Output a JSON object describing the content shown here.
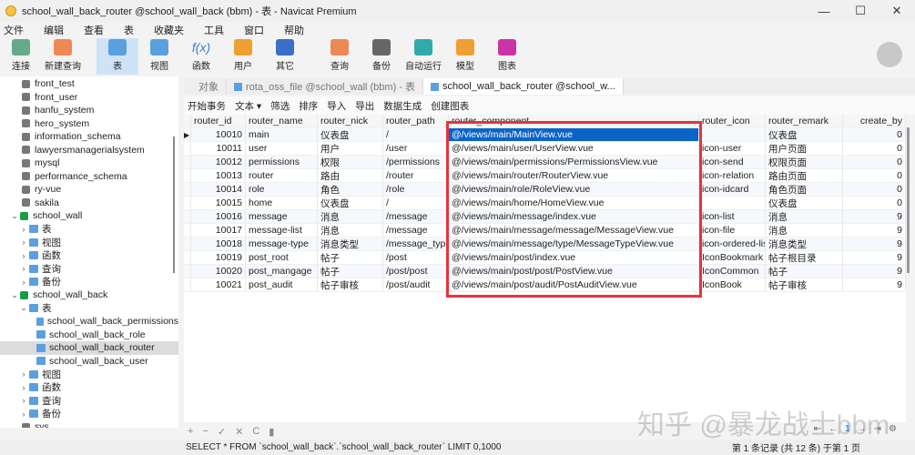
{
  "window": {
    "title": "school_wall_back_router @school_wall_back (bbm) - 表 - Navicat Premium",
    "controls": [
      "—",
      "☐",
      "✕"
    ]
  },
  "menu": [
    "文件",
    "编辑",
    "查看",
    "表",
    "收藏夹",
    "工具",
    "窗口",
    "帮助"
  ],
  "toolbar": [
    {
      "label": "连接",
      "icon": "plug-icon",
      "color": "#6a8"
    },
    {
      "label": "新建查询",
      "icon": "new-query-icon",
      "color": "#e85"
    },
    {
      "label": "表",
      "icon": "table-icon",
      "color": "#5aa0e0",
      "active": true
    },
    {
      "label": "视图",
      "icon": "view-icon",
      "color": "#5aa0e0"
    },
    {
      "label": "函数",
      "icon": "function-icon",
      "color": "#3a7bd5",
      "glyph": "f(x)"
    },
    {
      "label": "用户",
      "icon": "user-icon",
      "color": "#f0a030"
    },
    {
      "label": "其它",
      "icon": "other-icon",
      "color": "#3a6fc8"
    },
    {
      "label": "查询",
      "icon": "query-icon",
      "color": "#e85"
    },
    {
      "label": "备份",
      "icon": "backup-icon",
      "color": "#666"
    },
    {
      "label": "自动运行",
      "icon": "robot-icon",
      "color": "#3aa"
    },
    {
      "label": "模型",
      "icon": "model-icon",
      "color": "#f0a030"
    },
    {
      "label": "图表",
      "icon": "chart-icon",
      "color": "#c3a"
    }
  ],
  "sidebar": [
    {
      "label": "front_test",
      "level": 1,
      "type": "db"
    },
    {
      "label": "front_user",
      "level": 1,
      "type": "db"
    },
    {
      "label": "hanfu_system",
      "level": 1,
      "type": "db"
    },
    {
      "label": "hero_system",
      "level": 1,
      "type": "db"
    },
    {
      "label": "information_schema",
      "level": 1,
      "type": "db"
    },
    {
      "label": "lawyersmanagerialsystem",
      "level": 1,
      "type": "db"
    },
    {
      "label": "mysql",
      "level": 1,
      "type": "db"
    },
    {
      "label": "performance_schema",
      "level": 1,
      "type": "db"
    },
    {
      "label": "ry-vue",
      "level": 1,
      "type": "db"
    },
    {
      "label": "sakila",
      "level": 1,
      "type": "db"
    },
    {
      "label": "school_wall",
      "level": 0,
      "type": "dbopen",
      "chev": "⌄"
    },
    {
      "label": "表",
      "level": 1,
      "type": "folder",
      "chev": "›"
    },
    {
      "label": "视图",
      "level": 1,
      "type": "folder",
      "chev": "›"
    },
    {
      "label": "函数",
      "level": 1,
      "type": "folder",
      "chev": "›"
    },
    {
      "label": "查询",
      "level": 1,
      "type": "folder",
      "chev": "›"
    },
    {
      "label": "备份",
      "level": 1,
      "type": "folder",
      "chev": "›"
    },
    {
      "label": "school_wall_back",
      "level": 0,
      "type": "dbopen",
      "chev": "⌄"
    },
    {
      "label": "表",
      "level": 1,
      "type": "folder",
      "chev": "⌄"
    },
    {
      "label": "school_wall_back_permissions",
      "level": 2,
      "type": "table"
    },
    {
      "label": "school_wall_back_role",
      "level": 2,
      "type": "table"
    },
    {
      "label": "school_wall_back_router",
      "level": 2,
      "type": "table",
      "selected": true
    },
    {
      "label": "school_wall_back_user",
      "level": 2,
      "type": "table"
    },
    {
      "label": "视图",
      "level": 1,
      "type": "folder",
      "chev": "›"
    },
    {
      "label": "函数",
      "level": 1,
      "type": "folder",
      "chev": "›"
    },
    {
      "label": "查询",
      "level": 1,
      "type": "folder",
      "chev": "›"
    },
    {
      "label": "备份",
      "level": 1,
      "type": "folder",
      "chev": "›"
    },
    {
      "label": "sys",
      "level": 1,
      "type": "db"
    }
  ],
  "tabs": [
    {
      "label": "对象"
    },
    {
      "label": "rota_oss_file @school_wall (bbm) - 表"
    },
    {
      "label": "school_wall_back_router @school_w...",
      "active": true
    }
  ],
  "subtoolbar": [
    "开始事务",
    "文本 ▾",
    "筛选",
    "排序",
    "导入",
    "导出",
    "数据生成",
    "创建图表"
  ],
  "grid": {
    "columns": [
      "router_id",
      "router_name",
      "router_nick",
      "router_path",
      "router_component",
      "router_icon",
      "router_remark",
      "create_by"
    ],
    "rows": [
      [
        "10010",
        "main",
        "仪表盘",
        "/",
        "@/views/main/MainView.vue",
        "",
        "仪表盘",
        "0"
      ],
      [
        "10011",
        "user",
        "用户",
        "/user",
        "@/views/main/user/UserView.vue",
        "icon-user",
        "用户页面",
        "0"
      ],
      [
        "10012",
        "permissions",
        "权限",
        "/permissions",
        "@/views/main/permissions/PermissionsView.vue",
        "icon-send",
        "权限页面",
        "0"
      ],
      [
        "10013",
        "router",
        "路由",
        "/router",
        "@/views/main/router/RouterView.vue",
        "icon-relation",
        "路由页面",
        "0"
      ],
      [
        "10014",
        "role",
        "角色",
        "/role",
        "@/views/main/role/RoleView.vue",
        "icon-idcard",
        "角色页面",
        "0"
      ],
      [
        "10015",
        "home",
        "仪表盘",
        "/",
        "@/views/main/home/HomeView.vue",
        "",
        "仪表盘",
        "0"
      ],
      [
        "10016",
        "message",
        "消息",
        "/message",
        "@/views/main/message/index.vue",
        "icon-list",
        "消息",
        "9"
      ],
      [
        "10017",
        "message-list",
        "消息",
        "/message",
        "@/views/main/message/message/MessageView.vue",
        "icon-file",
        "消息",
        "9"
      ],
      [
        "10018",
        "message-type",
        "消息类型",
        "/message_type",
        "@/views/main/message/type/MessageTypeView.vue",
        "icon-ordered-lis",
        "消息类型",
        "9"
      ],
      [
        "10019",
        "post_root",
        "帖子",
        "/post",
        "@/views/main/post/index.vue",
        "IconBookmark",
        "帖子根目录",
        "9"
      ],
      [
        "10020",
        "post_mangage",
        "帖子",
        "/post/post",
        "@/views/main/post/post/PostView.vue",
        "IconCommon",
        "帖子",
        "9"
      ],
      [
        "10021",
        "post_audit",
        "帖子审核",
        "/post/audit",
        "@/views/main/post/audit/PostAuditView.vue",
        "IconBook",
        "帖子审核",
        "9"
      ]
    ]
  },
  "bottom_toolbar": [
    "+",
    "−",
    "✓",
    "✕",
    "C",
    "▮"
  ],
  "pager": {
    "buttons": [
      "⇤",
      "←",
      "→",
      "⇥",
      "⚙"
    ],
    "page": "1"
  },
  "status": {
    "sql": "SELECT * FROM `school_wall_back`.`school_wall_back_router` LIMIT 0,1000",
    "record": "第 1 条记录 (共 12 条) 于第 1 页"
  },
  "watermark": "知乎 @暴龙战士bbm",
  "highlight_color": "#e8323c"
}
